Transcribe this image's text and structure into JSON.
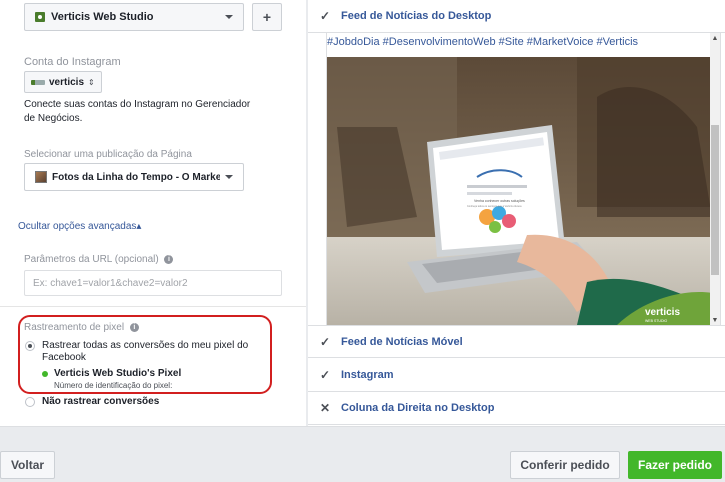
{
  "left": {
    "page_select_label": "Verticis Web Studio",
    "plus_label": "+",
    "instagram_account_label": "Conta do Instagram",
    "instagram_select_value": "verticis",
    "instagram_desc": "Conecte suas contas do Instagram no Gerenciador de Negócios.",
    "post_section_label": "Selecionar uma publicação da Página",
    "post_select_value": "Fotos da Linha do Tempo - O MarketVo...",
    "advanced_link": "Ocultar opções avançadas▴",
    "url_params_label": "Parâmetros da URL",
    "url_params_optional": "(opcional)",
    "url_params_placeholder": "Ex: chave1=valor1&chave2=valor2",
    "pixel_label": "Rastreamento de pixel",
    "pixel_track_all": "Rastrear todas as conversões do meu pixel do Facebook",
    "pixel_name": "Verticis Web Studio's Pixel",
    "pixel_id_label": "Número de identificação do pixel:",
    "pixel_no_track": "Não rastrear conversões"
  },
  "right": {
    "placements": [
      {
        "label": "Feed de Notícias do Desktop",
        "icon": "check-icon"
      },
      {
        "label": "Feed de Notícias Móvel",
        "icon": "check-icon"
      },
      {
        "label": "Instagram",
        "icon": "check-icon"
      },
      {
        "label": "Coluna da Direita no Desktop",
        "icon": "close-icon"
      }
    ],
    "hashtags": "#JobdoDia #DesenvolvimentoWeb #Site #MarketVoice #Verticis",
    "image_brand": "verticis",
    "image_brand_sub": "WEB STUDIO",
    "screen_heading": "Venha conhecer outras soluções",
    "screen_sub": "Conheça todos os serviços que a Verticis oferece"
  },
  "bottom": {
    "back_label": "Voltar",
    "review_label": "Conferir pedido",
    "order_label": "Fazer pedido"
  },
  "colors": {
    "link": "#365899",
    "green": "#42b72a",
    "highlight": "#d21f1f"
  }
}
